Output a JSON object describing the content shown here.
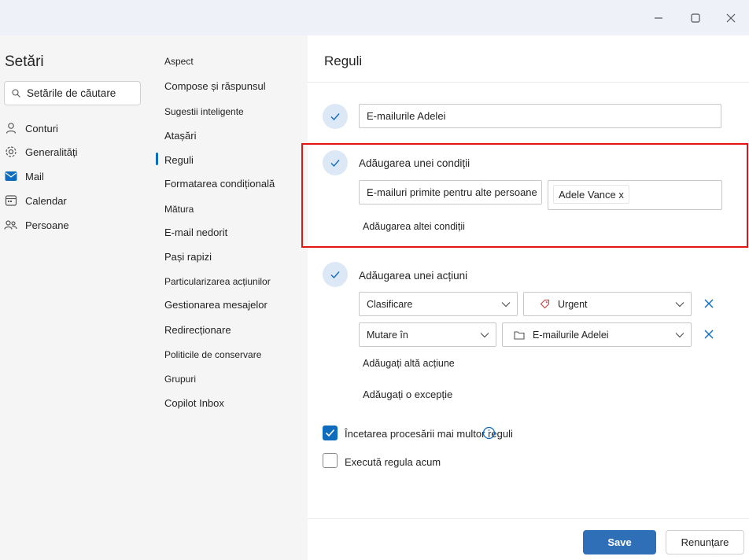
{
  "left": {
    "title": "Setări",
    "search_placeholder": "Setările de căutare",
    "nav": [
      {
        "label": "Conturi",
        "icon": "person-icon"
      },
      {
        "label": "Generalități",
        "icon": "gear-icon"
      },
      {
        "label": "Mail",
        "icon": "mail-icon"
      },
      {
        "label": "Calendar",
        "icon": "calendar-icon"
      },
      {
        "label": "Persoane",
        "icon": "people-icon"
      }
    ]
  },
  "menu": {
    "items": [
      "Aspect",
      "Compose și răspunsul",
      "Sugestii inteligente",
      "Atașări",
      "Reguli",
      "Formatarea condițională",
      "Mătura",
      "E-mail nedorit",
      "Pași rapizi",
      "Particularizarea acțiunilor",
      "Gestionarea mesajelor",
      "Redirecționare",
      "Politicile de conservare",
      "Grupuri",
      "Copilot Inbox"
    ],
    "selected": "Reguli"
  },
  "content": {
    "title": "Reguli",
    "rule_name": "E-mailurile Adelei",
    "condition": {
      "label": "Adăugarea unei condiții",
      "type": "E-mailuri primite pentru alte persoane",
      "person_tag": "Adele Vance x",
      "add_another": "Adăugarea altei condiții"
    },
    "action": {
      "label": "Adăugarea unei acțiuni",
      "row1_action": "Clasificare",
      "row1_value": "Urgent",
      "row2_action": "Mutare în",
      "row2_value": "E-mailurile Adelei",
      "add_another": "Adăugați altă acțiune",
      "add_exception": "Adăugați o excepție"
    },
    "stop_processing": "Încetarea procesării mai multor reguli",
    "run_now": "Execută regula acum"
  },
  "footer": {
    "save": "Save",
    "cancel": "Renunțare"
  },
  "colors": {
    "accent": "#0f6cbd",
    "highlight": "#e31414"
  }
}
